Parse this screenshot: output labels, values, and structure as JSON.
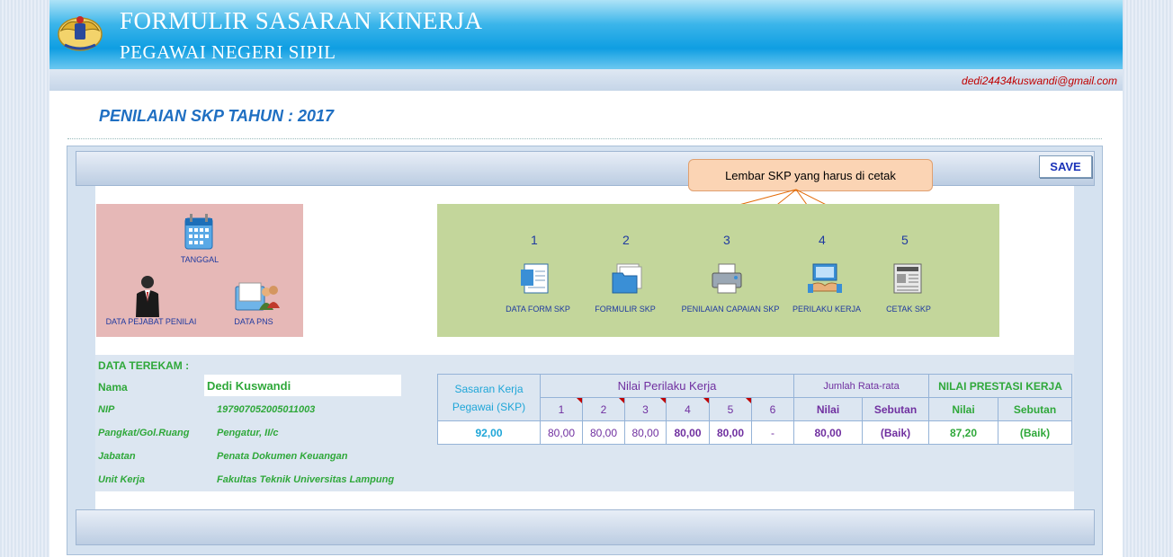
{
  "header": {
    "title": "FORMULIR SASARAN KINERJA",
    "subtitle": "PEGAWAI NEGERI SIPIL",
    "email": "dedi24434kuswandi@gmail.com"
  },
  "page": {
    "title": "PENILAIAN SKP TAHUN : 2017"
  },
  "toolbar": {
    "save_label": "SAVE"
  },
  "callout": {
    "text": "Lembar SKP yang harus di cetak"
  },
  "left_menu": {
    "tanggal": "TANGGAL",
    "data_pejabat": "DATA PEJABAT PENILAI",
    "data_pns": "DATA PNS"
  },
  "print_menu": [
    {
      "num": "1",
      "label": "DATA FORM SKP",
      "icon": "document-form-icon"
    },
    {
      "num": "2",
      "label": "FORMULIR SKP",
      "icon": "folder-icon"
    },
    {
      "num": "3",
      "label": "PENILAIAN CAPAIAN SKP",
      "icon": "printer-icon"
    },
    {
      "num": "4",
      "label": "PERILAKU KERJA",
      "icon": "handshake-computer-icon"
    },
    {
      "num": "5",
      "label": "CETAK SKP",
      "icon": "newspaper-icon"
    }
  ],
  "employee": {
    "section_title": "DATA TEREKAM :",
    "name_label": "Nama",
    "name": "Dedi Kuswandi",
    "nip_label": "NIP",
    "nip": "197907052005011003",
    "pangkat_label": "Pangkat/Gol.Ruang",
    "pangkat": "Pengatur, II/c",
    "jabatan_label": "Jabatan",
    "jabatan": "Penata Dokumen Keuangan",
    "unit_label": "Unit Kerja",
    "unit": "Fakultas Teknik Universitas Lampung"
  },
  "score_table": {
    "skp_header": "Sasaran Kerja Pegawai (SKP)",
    "perilaku_header": "Nilai Perilaku Kerja",
    "jumlah_header": "Jumlah Rata-rata",
    "prestasi_header": "NILAI PRESTASI KERJA",
    "cols": [
      "1",
      "2",
      "3",
      "4",
      "5",
      "6"
    ],
    "nilai": "Nilai",
    "sebutan": "Sebutan",
    "skp_value": "92,00",
    "perilaku_values": [
      "80,00",
      "80,00",
      "80,00",
      "80,00",
      "80,00",
      "-"
    ],
    "jumlah_nilai": "80,00",
    "jumlah_sebutan": "(Baik)",
    "prestasi_nilai": "87,20",
    "prestasi_sebutan": "(Baik)"
  },
  "colors": {
    "accent": "#1f6fc2",
    "green": "#2fa83a",
    "purple": "#7030a0",
    "header_blue": "#0f9ee2"
  }
}
